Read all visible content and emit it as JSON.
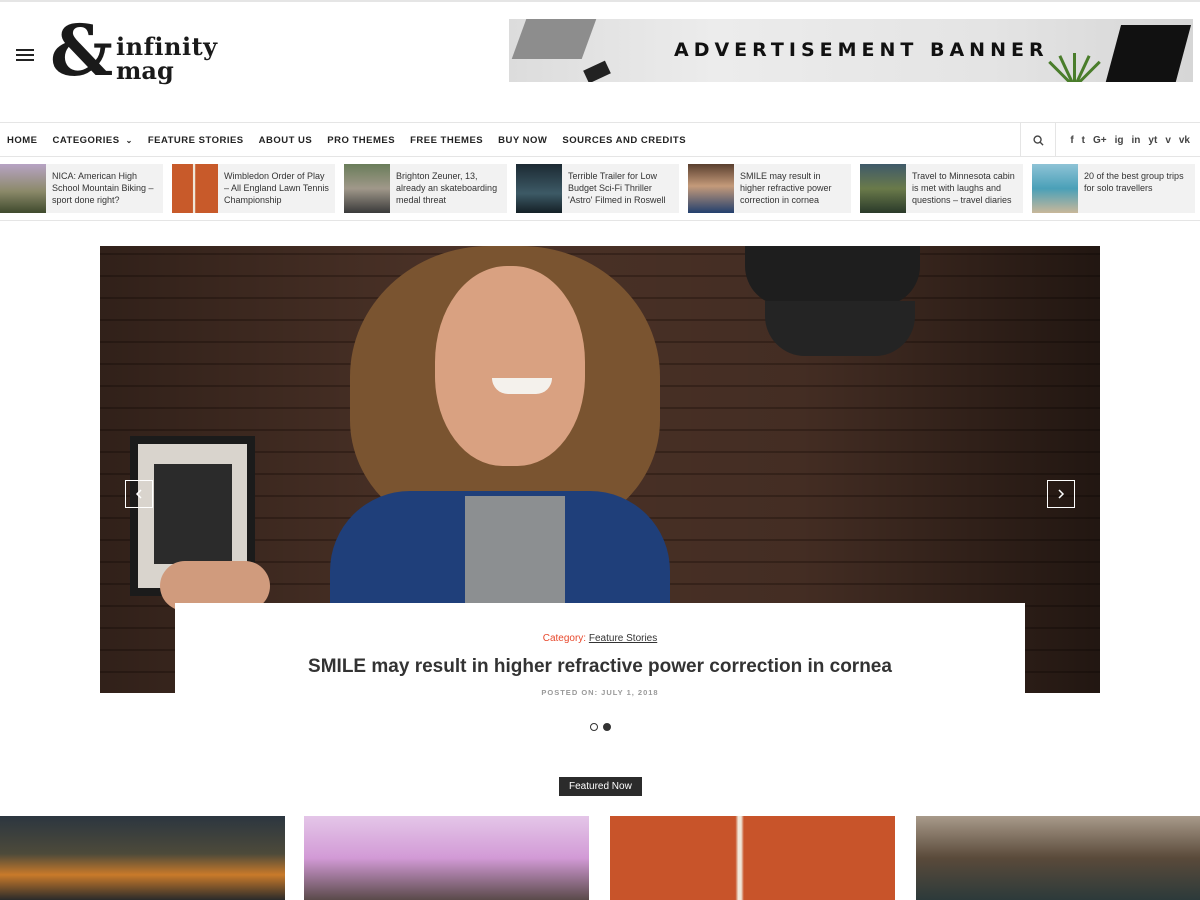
{
  "header": {
    "logo": {
      "amp": "&",
      "line1": "infinity",
      "line2": "mag"
    },
    "ad_banner": "ADVERTISEMENT BANNER"
  },
  "nav": {
    "items": [
      {
        "label": "HOME"
      },
      {
        "label": "CATEGORIES",
        "has_dropdown": true
      },
      {
        "label": "FEATURE STORIES"
      },
      {
        "label": "ABOUT US"
      },
      {
        "label": "PRO THEMES"
      },
      {
        "label": "FREE THEMES"
      },
      {
        "label": "BUY NOW"
      },
      {
        "label": "SOURCES AND CREDITS"
      }
    ],
    "social": [
      "f",
      "t",
      "G+",
      "ig",
      "in",
      "yt",
      "v",
      "vk"
    ]
  },
  "ticker": [
    {
      "text": "NICA: American High School Mountain Biking – sport done right?"
    },
    {
      "text": "Wimbledon Order of Play – All England Lawn Tennis Championship"
    },
    {
      "text": "Brighton Zeuner, 13, already an skateboarding medal threat"
    },
    {
      "text": "Terrible Trailer for Low Budget Sci-Fi Thriller 'Astro' Filmed in Roswell"
    },
    {
      "text": "SMILE may result in higher refractive power correction in cornea"
    },
    {
      "text": "Travel to Minnesota cabin is met with laughs and questions – travel diaries"
    },
    {
      "text": "20 of the best group trips for solo travellers"
    }
  ],
  "slider": {
    "category_label": "Category:",
    "category": "Feature Stories",
    "title": "SMILE may result in higher refractive power correction in cornea",
    "date": "POSTED ON: JULY 1, 2018",
    "active_dot": 2
  },
  "featured": {
    "label": "Featured Now"
  },
  "colors": {
    "accent": "#e8492d",
    "dark": "#2b2b2b"
  }
}
